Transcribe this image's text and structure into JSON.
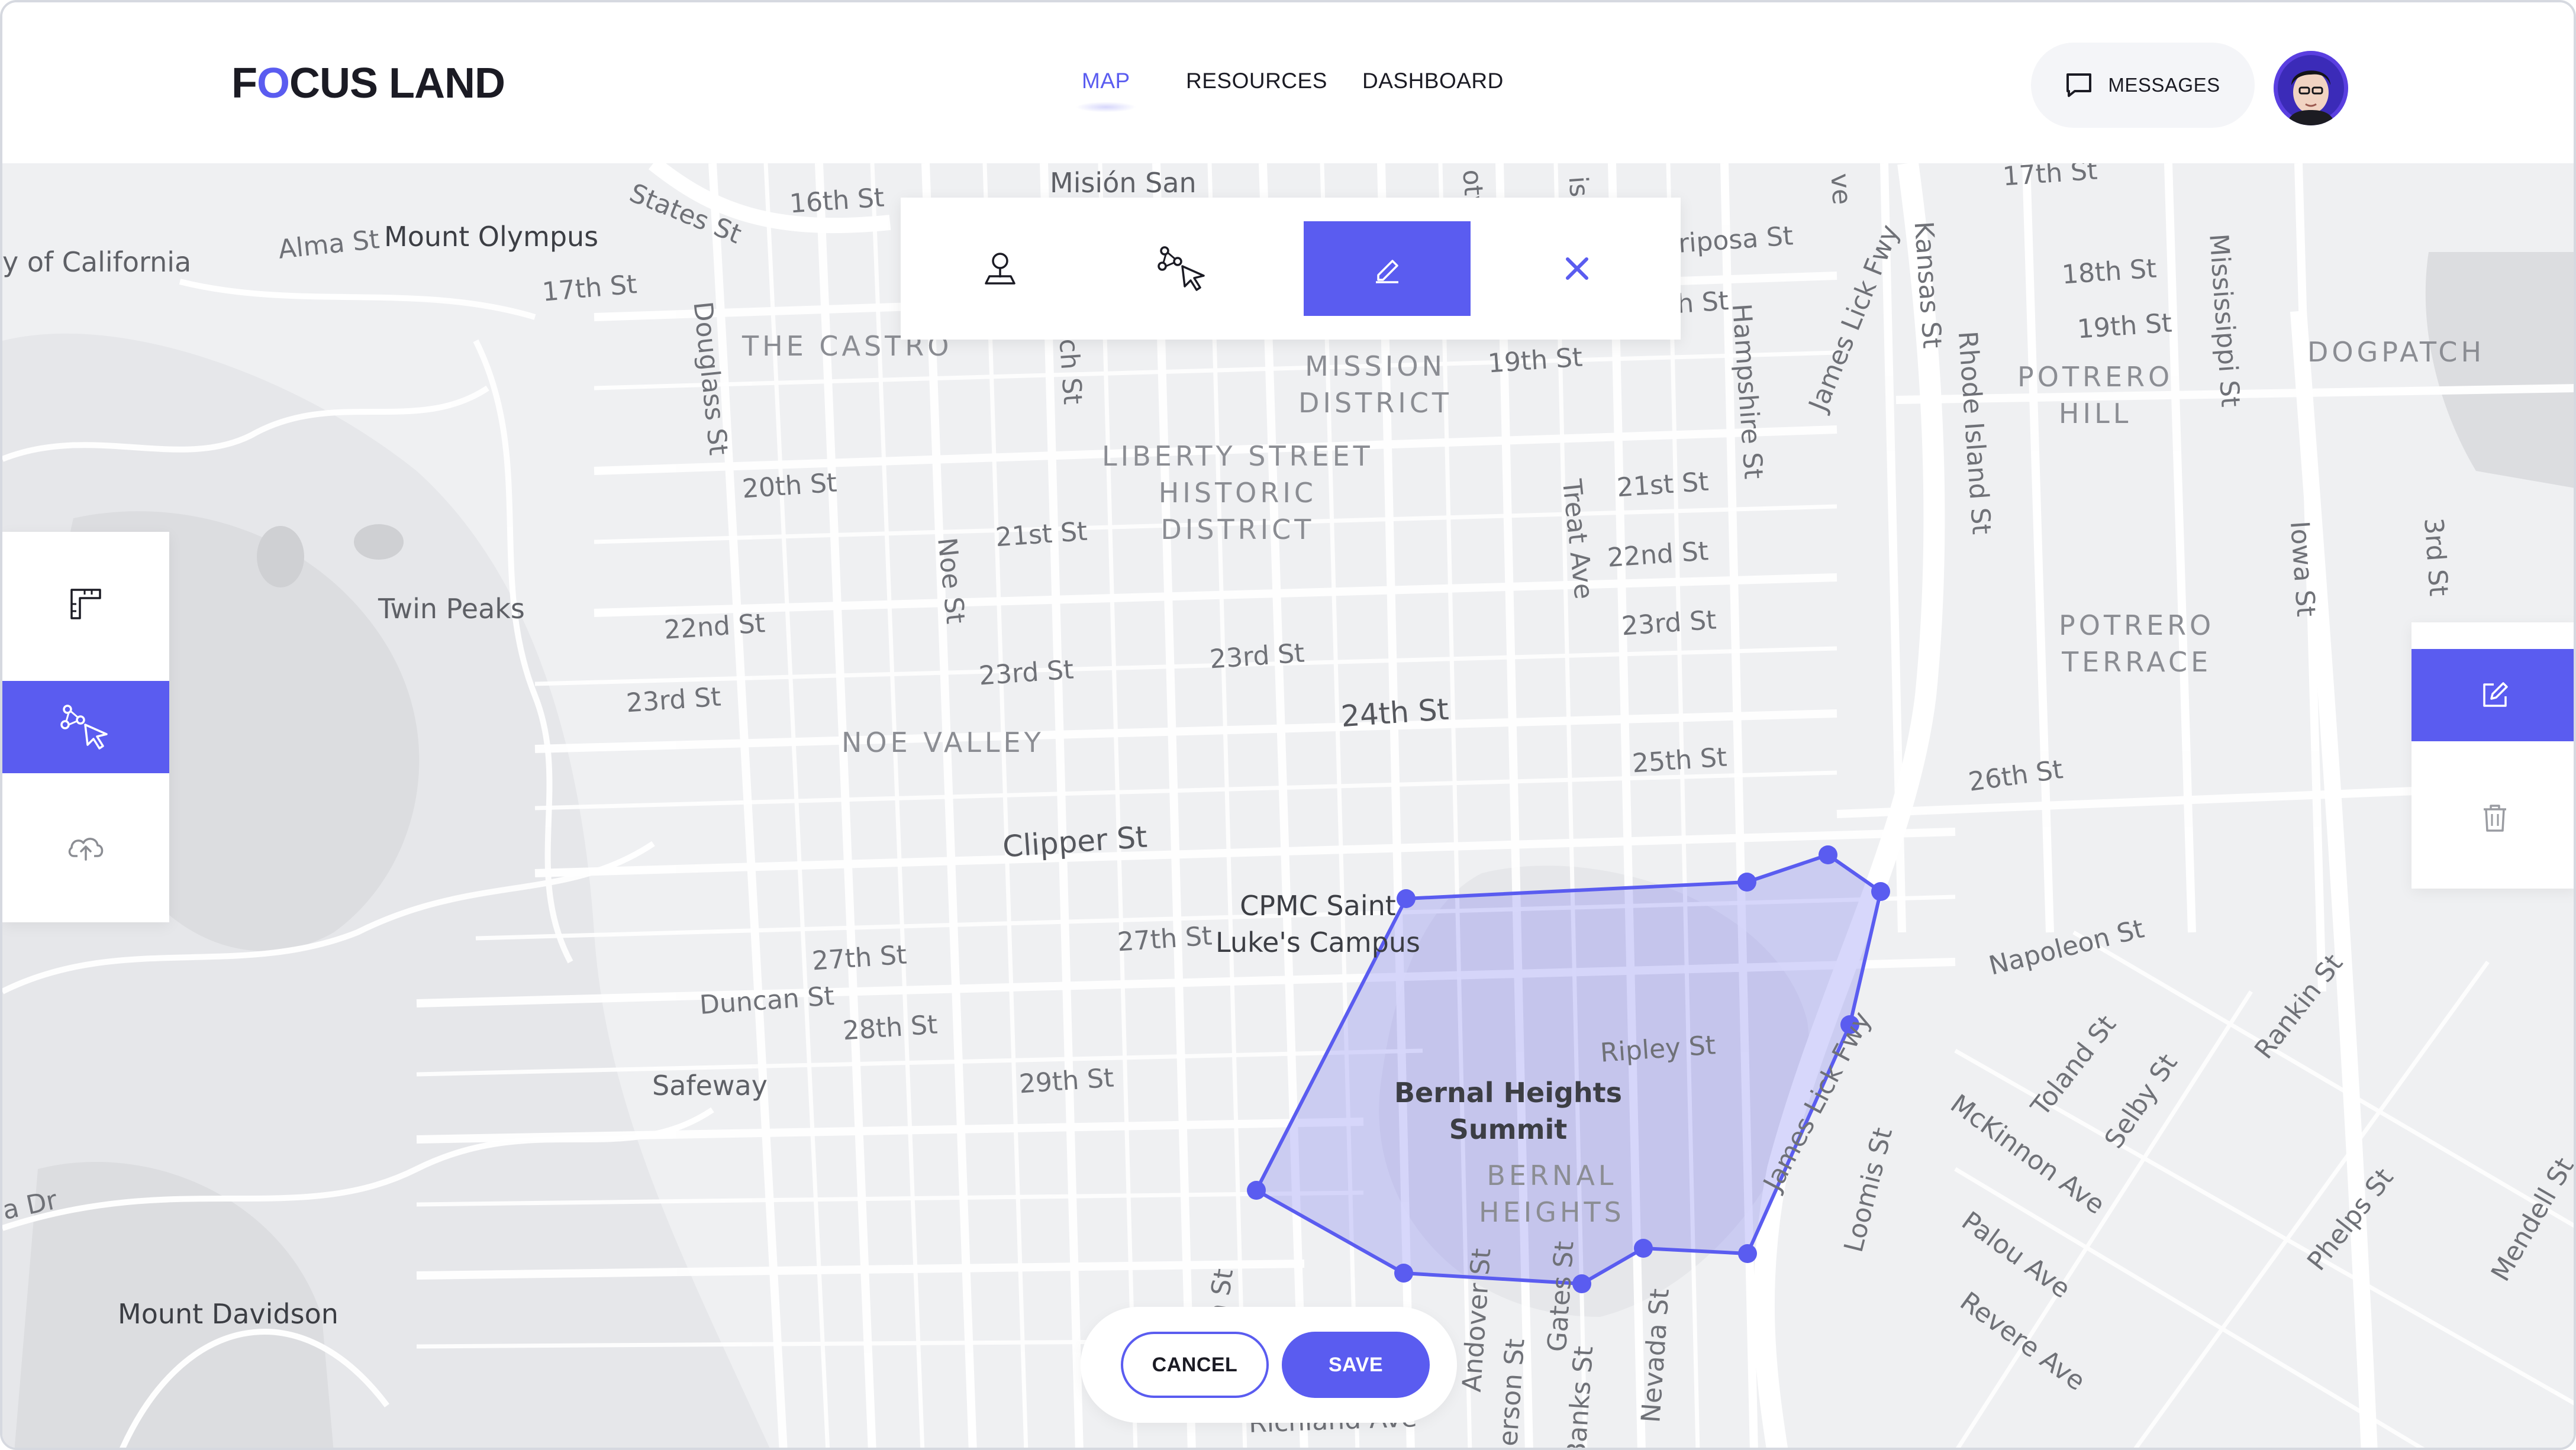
{
  "app": {
    "logo": {
      "prefix": "F",
      "highlight": "O",
      "suffix": "CUS LAND"
    },
    "accent_color": "#5a5cf0"
  },
  "nav": {
    "items": [
      {
        "label": "MAP",
        "active": true
      },
      {
        "label": "RESOURCES",
        "active": false
      },
      {
        "label": "DASHBOARD",
        "active": false
      }
    ]
  },
  "header": {
    "messages_label": "MESSAGES",
    "messages_icon": "chat-bubble-icon",
    "avatar_icon": "user-avatar"
  },
  "toolbar": {
    "tools": [
      {
        "name": "pin",
        "icon": "map-pin-icon",
        "active": false
      },
      {
        "name": "select",
        "icon": "node-pointer-icon",
        "active": false
      },
      {
        "name": "edit",
        "icon": "pencil-icon",
        "active": true
      },
      {
        "name": "close",
        "icon": "close-icon",
        "active": false
      }
    ]
  },
  "left_panel": {
    "buttons": [
      {
        "name": "ruler",
        "icon": "ruler-icon",
        "active": false
      },
      {
        "name": "draw-polygon",
        "icon": "node-pointer-icon",
        "active": true
      },
      {
        "name": "upload",
        "icon": "cloud-upload-icon",
        "active": false
      }
    ]
  },
  "right_panel": {
    "buttons": [
      {
        "name": "edit",
        "icon": "edit-square-icon",
        "active": true
      },
      {
        "name": "delete",
        "icon": "trash-icon",
        "active": false
      }
    ]
  },
  "actions": {
    "cancel_label": "CANCEL",
    "save_label": "SAVE"
  },
  "map": {
    "districts": [
      {
        "id": "castro",
        "text": "THE CASTRO"
      },
      {
        "id": "mission",
        "text": "MISSION\nDISTRICT"
      },
      {
        "id": "liberty",
        "text": "LIBERTY STREET\nHISTORIC\nDISTRICT"
      },
      {
        "id": "noe",
        "text": "NOE VALLEY"
      },
      {
        "id": "potrero_hill",
        "text": "POTRERO\nHILL"
      },
      {
        "id": "potrero_terrace",
        "text": "POTRERO\nTERRACE"
      },
      {
        "id": "dogpatch",
        "text": "DOGPATCH"
      },
      {
        "id": "bernal",
        "text": "BERNAL\nHEIGHTS"
      }
    ],
    "places": [
      {
        "id": "mount_olympus",
        "text": "Mount Olympus"
      },
      {
        "id": "twin_peaks",
        "text": "Twin Peaks"
      },
      {
        "id": "mount_davidson",
        "text": "Mount Davidson"
      },
      {
        "id": "safeway",
        "text": "Safeway"
      },
      {
        "id": "cpmc",
        "text": "CPMC Saint\nLuke's Campus"
      },
      {
        "id": "bernal_summit",
        "text": "Bernal Heights\nSummit"
      },
      {
        "id": "university",
        "text": "y of California"
      },
      {
        "id": "mision_san",
        "text": "Misión San"
      }
    ],
    "streets": [
      {
        "id": "alma",
        "text": "Alma St"
      },
      {
        "id": "states",
        "text": "States St"
      },
      {
        "id": "s16",
        "text": "16th St"
      },
      {
        "id": "s17",
        "text": "17th St"
      },
      {
        "id": "douglass",
        "text": "Douglass St"
      },
      {
        "id": "s20",
        "text": "20th St"
      },
      {
        "id": "s21a",
        "text": "21st St"
      },
      {
        "id": "s22a",
        "text": "22nd St"
      },
      {
        "id": "s23a",
        "text": "23rd St"
      },
      {
        "id": "s23b",
        "text": "23rd St"
      },
      {
        "id": "s23c",
        "text": "23rd St"
      },
      {
        "id": "noe_st",
        "text": "Noe St"
      },
      {
        "id": "s24",
        "text": "24th St"
      },
      {
        "id": "s25",
        "text": "25th St"
      },
      {
        "id": "s26",
        "text": "26th St"
      },
      {
        "id": "clipper",
        "text": "Clipper St"
      },
      {
        "id": "s27a",
        "text": "27th St"
      },
      {
        "id": "s27b",
        "text": "27th St"
      },
      {
        "id": "duncan",
        "text": "Duncan St"
      },
      {
        "id": "s28",
        "text": "28th St"
      },
      {
        "id": "s29",
        "text": "29th St"
      },
      {
        "id": "s19",
        "text": "19th St"
      },
      {
        "id": "s18",
        "text": "18th St"
      },
      {
        "id": "s19b",
        "text": "19th St"
      },
      {
        "id": "s21b",
        "text": "21st St"
      },
      {
        "id": "s22b",
        "text": "22nd St"
      },
      {
        "id": "s23d",
        "text": "23rd St"
      },
      {
        "id": "treat",
        "text": "Treat Ave"
      },
      {
        "id": "hampshire",
        "text": "Hampshire St"
      },
      {
        "id": "mariposa",
        "text": "riposa St"
      },
      {
        "id": "james_lick",
        "text": "James Lick Fwy"
      },
      {
        "id": "kansas",
        "text": "Kansas St"
      },
      {
        "id": "rhode",
        "text": "Rhode Island St"
      },
      {
        "id": "mississippi",
        "text": "Mississippi St"
      },
      {
        "id": "iowa",
        "text": "Iowa St"
      },
      {
        "id": "third",
        "text": "3rd St"
      },
      {
        "id": "s17b",
        "text": "17th St"
      },
      {
        "id": "napoleon",
        "text": "Napoleon St"
      },
      {
        "id": "toland",
        "text": "Toland St"
      },
      {
        "id": "selby",
        "text": "Selby St"
      },
      {
        "id": "rankin",
        "text": "Rankin St"
      },
      {
        "id": "mckinnon",
        "text": "McKinnon Ave"
      },
      {
        "id": "palou",
        "text": "Palou Ave"
      },
      {
        "id": "revere",
        "text": "Revere Ave"
      },
      {
        "id": "phelps",
        "text": "Phelps St"
      },
      {
        "id": "mendell",
        "text": "Mendell St"
      },
      {
        "id": "loomis",
        "text": "Loomis St"
      },
      {
        "id": "james_lick2",
        "text": "James Lick Fwy"
      },
      {
        "id": "ripley",
        "text": "Ripley St"
      },
      {
        "id": "nevada",
        "text": "Nevada St"
      },
      {
        "id": "banks",
        "text": "Banks St"
      },
      {
        "id": "gates",
        "text": "Gates St"
      },
      {
        "id": "anderson",
        "text": "nderson St"
      },
      {
        "id": "andover",
        "text": "Andover St"
      },
      {
        "id": "richland",
        "text": "Richland Ave"
      },
      {
        "id": "ondst",
        "text": "on St"
      },
      {
        "id": "adr",
        "text": "a Dr"
      },
      {
        "id": "church",
        "text": "rch St"
      },
      {
        "id": "s_h_st",
        "text": "h St"
      },
      {
        "id": "ve",
        "text": "ve"
      },
      {
        "id": "otv",
        "text": "otv"
      },
      {
        "id": "isi",
        "text": "isi"
      }
    ]
  }
}
